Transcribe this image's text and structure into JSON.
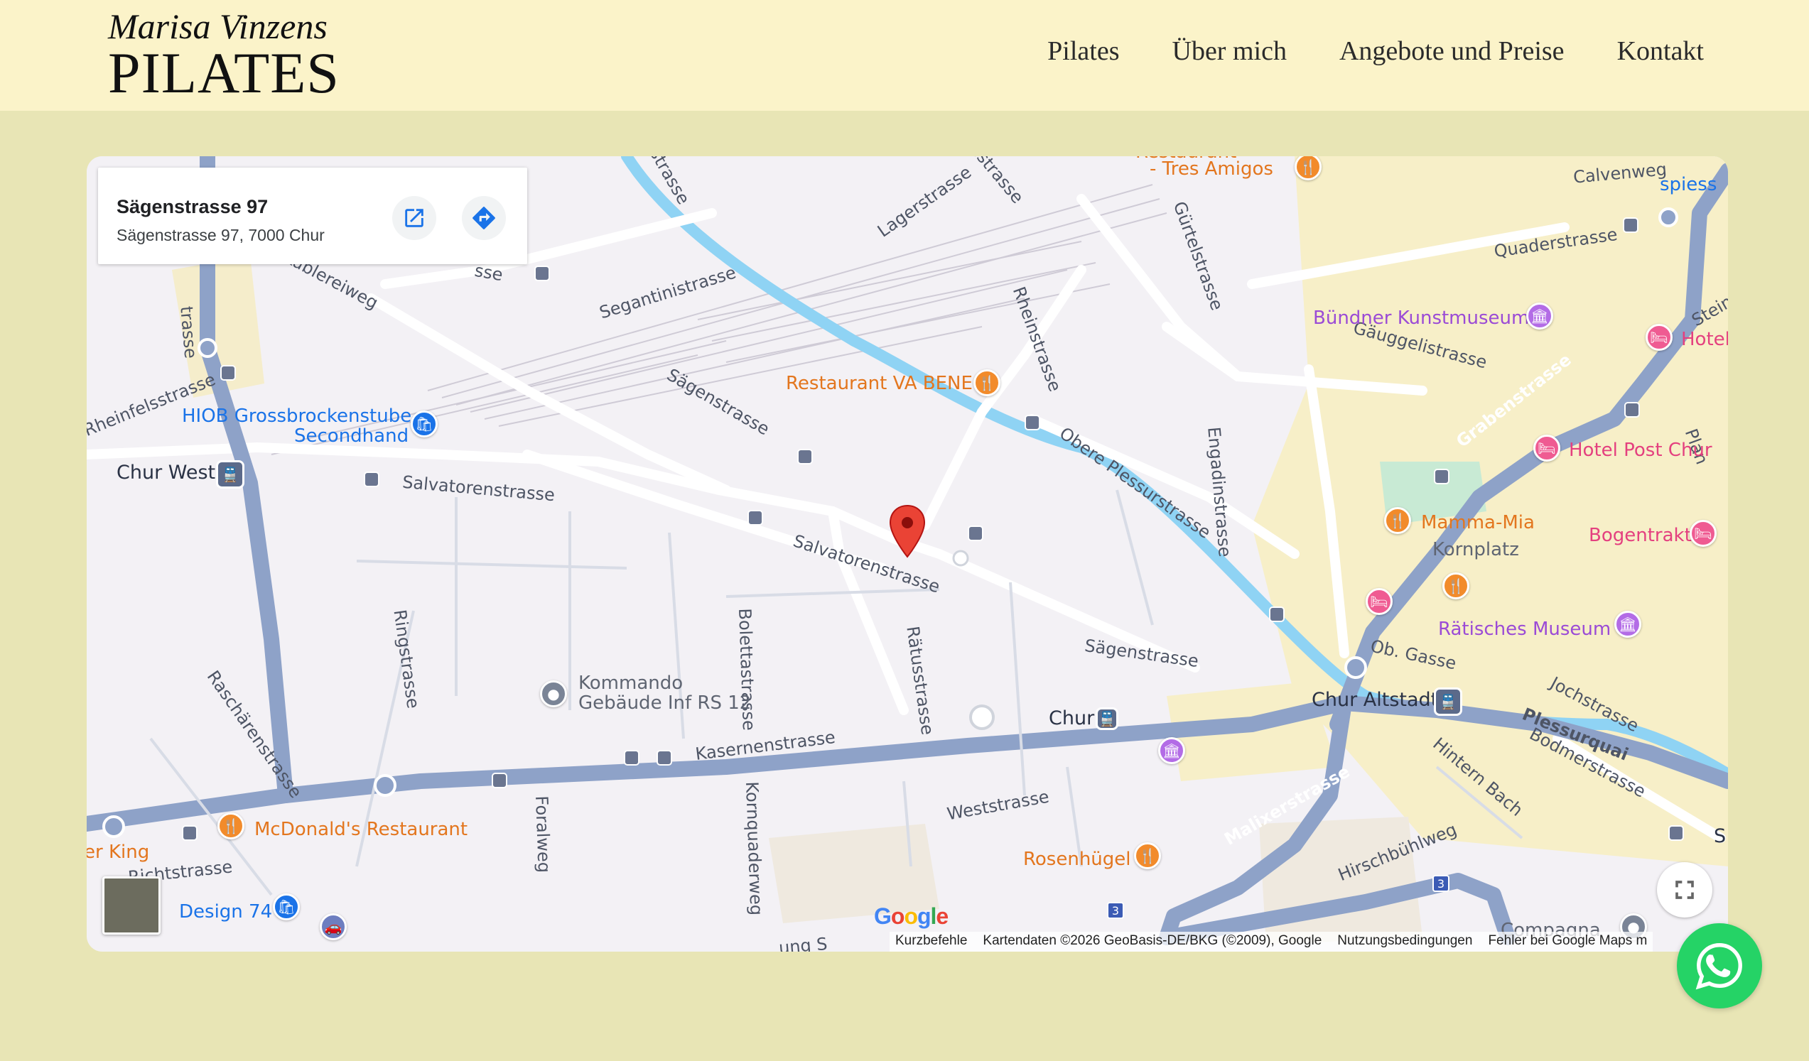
{
  "header": {
    "logo_line1": "Marisa Vinzens",
    "logo_line2": "PILATES",
    "nav": [
      "Pilates",
      "Über mich",
      "Angebote und Preise",
      "Kontakt"
    ]
  },
  "map": {
    "info_card": {
      "title": "Sägenstrasse 97",
      "address": "Sägenstrasse 97, 7000 Chur",
      "open_icon": "open-in-new-icon",
      "directions_icon": "directions-icon"
    },
    "streets": {
      "segantinistrasse": "Segantinistrasse",
      "saegenstrasse_a": "Sägenstrasse",
      "saegenstrasse_b": "Sägenstrasse",
      "salvatorenstrasse_a": "Salvatorenstrasse",
      "salvatorenstrasse_b": "Salvatorenstrasse",
      "raetusstrasse": "Rätusstrasse",
      "ringstrasse": "Ringstrasse",
      "raschaerenstrasse": "Raschärenstrasse",
      "kasernenstrasse": "Kasernenstrasse",
      "weststrasse": "Weststrasse",
      "bolettastrasse": "Bolettastrasse",
      "kornquaderweg": "Kornquaderweg",
      "foralweg": "Foralweg",
      "lagerstrasse": "Lagerstrasse",
      "rheinstrasse": "Rheinstrasse",
      "guertelstrasse": "Gürtelstrasse",
      "obere_plessurstrasse": "Obere Plessurstrasse",
      "engadinstrasse": "Engadinstrasse",
      "gaeuggelistrasse": "Gäuggelistrasse",
      "quaderstrasse": "Quaderstrasse",
      "calvenweg": "Calvenweg",
      "grabenstrasse": "Grabenstrasse",
      "malixerstrasse": "Malixerstrasse",
      "plessurquai": "Plessurquai",
      "bodmerstrasse": "Bodmerstrasse",
      "jochstrasse": "Jochstrasse",
      "hintern_bach": "Hintern Bach",
      "hirschbuehlweg": "Hirschbühlweg",
      "ob_gasse": "Ob. Gasse",
      "rheinfelsstrasse": "Rheinfelsstrasse",
      "kublereiweg": "Kublereiweg",
      "strasse_left": "trasse",
      "sse_top": "sse",
      "rstrasse": "rstrasse",
      "nstrasse": "nstrasse",
      "richtstrasse": "Richtstrasse",
      "ngs": "ung S",
      "steinb": "Steinb",
      "plan": "Plan"
    },
    "places": {
      "tres_amigos_line1": "Restaurant",
      "tres_amigos_line2": "- Tres Amigos",
      "va_bene": "Restaurant VA BENE",
      "hiob_line1": "HIOB Grossbrockenstube",
      "hiob_line2": "Secondhand",
      "chur_west": "Chur West",
      "kommando_line1": "Kommando",
      "kommando_line2": "Gebäude Inf RS 12",
      "mcdonalds": "McDonald's Restaurant",
      "burger_king": "er King",
      "design74": "Design 74",
      "rosenhuegel": "Rosenhügel",
      "chur": "Chur",
      "chur_altstadt": "Chur Altstadt",
      "buendner_kunstmuseum": "Bündner Kunstmuseum",
      "hotel": "Hotel",
      "hotel_post_chur": "Hotel Post Chur",
      "mamma_mia": "Mamma-Mia",
      "kornplatz": "Kornplatz",
      "bogentrakt": "Bogentrakt",
      "raetisches_museum": "Rätisches Museum",
      "spiess": "spiess",
      "compagna": "Compagna",
      "s_right": "S"
    },
    "route_badge": "3",
    "google_logo": "Google",
    "attribution": [
      "Kurzbefehle",
      "Kartendaten ©2026 GeoBasis-DE/BKG (©2009), Google",
      "Nutzungsbedingungen",
      "Fehler bei Google Maps m"
    ],
    "colors": {
      "river": "#8fd3f4",
      "road": "#ffffff",
      "main_road": "#8ea2c8",
      "old_town": "#f7efc8",
      "park": "#c8ead4",
      "marker": "#ea4335"
    }
  },
  "whatsapp_icon": "whatsapp-icon"
}
